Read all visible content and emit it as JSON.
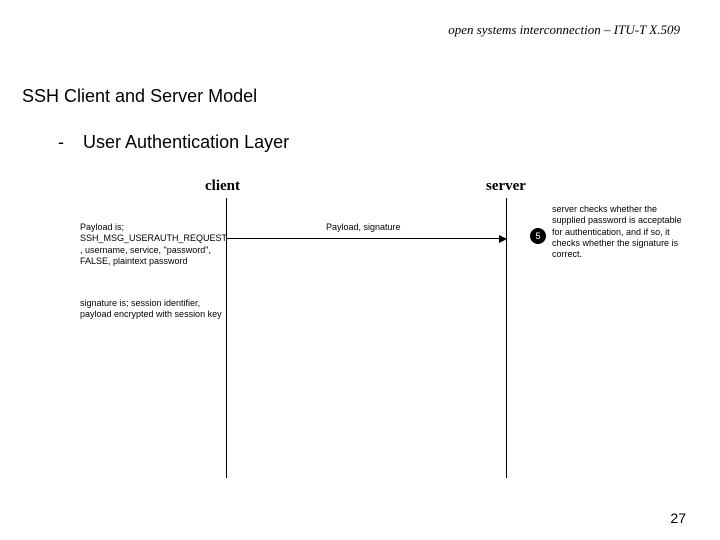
{
  "header": "open systems interconnection – ITU-T X.509",
  "title": "SSH Client and Server Model",
  "bullet_dash": "-",
  "subtitle": "User Authentication Layer",
  "client_label": "client",
  "server_label": "server",
  "message_label": "Payload, signature",
  "left_note_1": "Payload is; SSH_MSG_USERAUTH_REQUEST , username, service, \"password\", FALSE, plaintext password",
  "left_note_2": "signature is; session identifier, payload encrypted with session key",
  "step_number": "5",
  "right_note": "server checks whether the supplied password is acceptable for authentication, and if so, it checks whether the signature is correct.",
  "page_number": "27"
}
